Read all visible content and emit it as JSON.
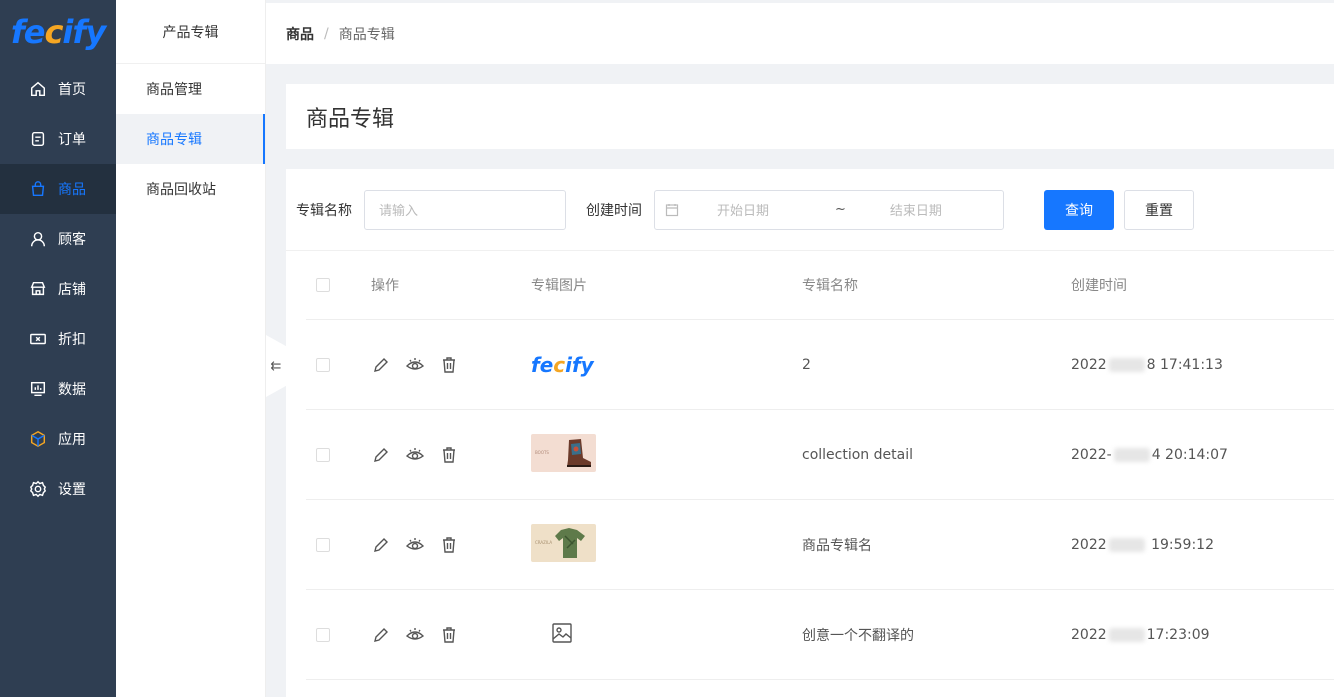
{
  "logo": {
    "text_pre": "fe",
    "text_dot": "c",
    "text_post": "ify"
  },
  "sidebar": {
    "items": [
      {
        "label": "首页",
        "icon": "home-icon"
      },
      {
        "label": "订单",
        "icon": "order-icon"
      },
      {
        "label": "商品",
        "icon": "bag-icon",
        "active": true
      },
      {
        "label": "顾客",
        "icon": "user-icon"
      },
      {
        "label": "店铺",
        "icon": "store-icon"
      },
      {
        "label": "折扣",
        "icon": "coupon-icon"
      },
      {
        "label": "数据",
        "icon": "chart-icon"
      },
      {
        "label": "应用",
        "icon": "cube-icon"
      },
      {
        "label": "设置",
        "icon": "gear-icon"
      }
    ]
  },
  "subnav": {
    "title": "产品专辑",
    "items": [
      {
        "label": "商品管理"
      },
      {
        "label": "商品专辑",
        "active": true
      },
      {
        "label": "商品回收站"
      }
    ]
  },
  "breadcrumb": {
    "parent": "商品",
    "separator": "/",
    "current": "商品专辑"
  },
  "page": {
    "title": "商品专辑"
  },
  "filters": {
    "name_label": "专辑名称",
    "name_placeholder": "请输入",
    "time_label": "创建时间",
    "start_placeholder": "开始日期",
    "range_sep": "~",
    "end_placeholder": "结束日期",
    "query_label": "查询",
    "reset_label": "重置"
  },
  "table": {
    "headers": {
      "ops": "操作",
      "image": "专辑图片",
      "name": "专辑名称",
      "time": "创建时间"
    },
    "rows": [
      {
        "image": "fecify-logo",
        "name": "2",
        "time_pre": "2022",
        "time_post": "8 17:41:13"
      },
      {
        "image": "boots-photo",
        "name": "collection detail",
        "time_pre": "2022-",
        "time_post": "4 20:14:07"
      },
      {
        "image": "shirt-photo",
        "name": "商品专辑名",
        "time_pre": "2022",
        "time_post": "19:59:12"
      },
      {
        "image": "placeholder-image-icon",
        "name": "创意一个不翻译的",
        "time_pre": "2022",
        "time_post": "17:23:09"
      }
    ]
  },
  "colors": {
    "primary": "#1677ff",
    "sidebar_bg": "#2f3e52",
    "accent_orange": "#f5a623"
  }
}
